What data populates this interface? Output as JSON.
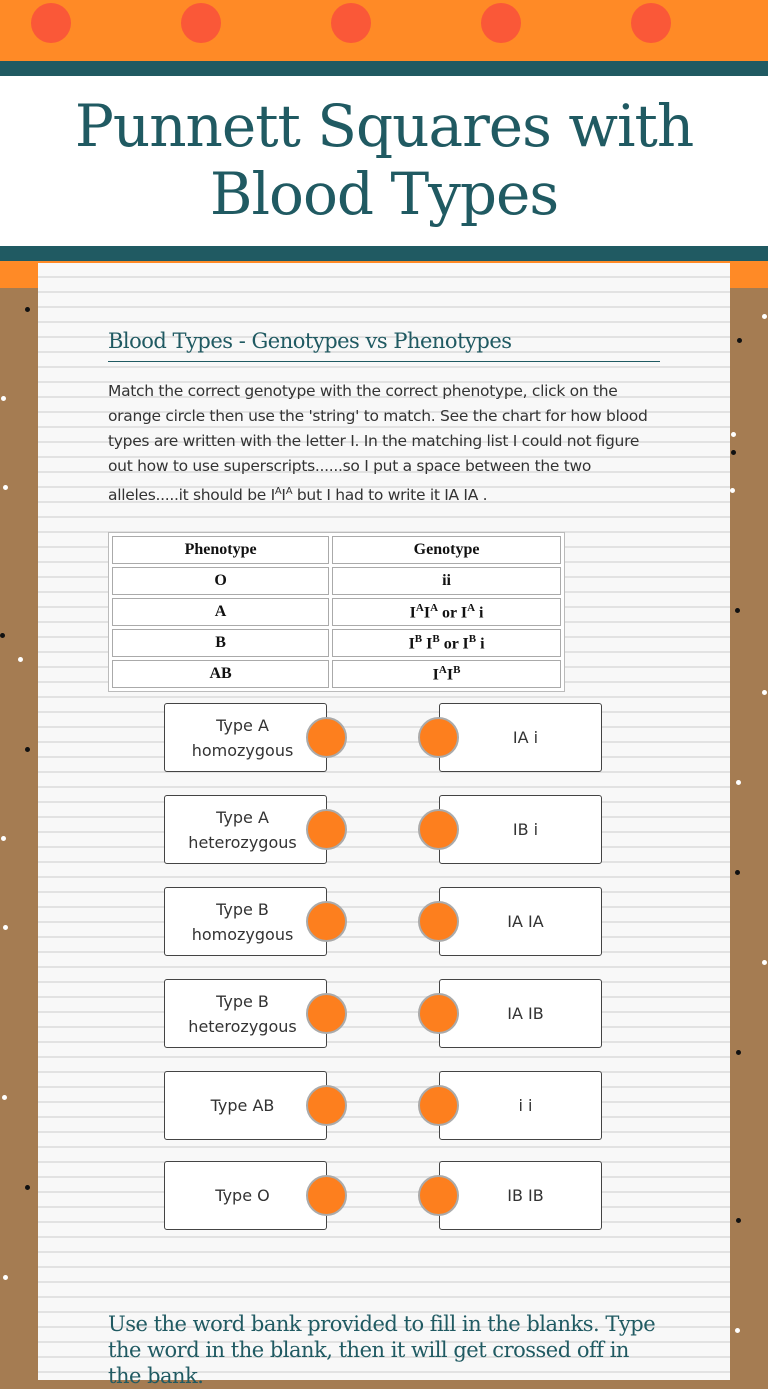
{
  "header": {
    "title": "Punnett Squares with Blood Types",
    "colors": {
      "orange": "#ff8a26",
      "dot": "#fa5838",
      "teal": "#205a62"
    }
  },
  "section": {
    "heading": "Blood Types - Genotypes vs Phenotypes",
    "instructions_part1": "Match the correct genotype with the correct phenotype, click on the orange circle then use the 'string' to match. See the chart for how blood types are written with the letter I.  In the matching list I could not figure out how to use superscripts......so I put a space between the two alleles.....it should be I",
    "instructions_sup1": "A",
    "instructions_mid": "I",
    "instructions_sup2": "A",
    "instructions_part2": "  but I had to write it IA IA ."
  },
  "table": {
    "headers": [
      "Phenotype",
      "Genotype"
    ],
    "rows": [
      {
        "phenotype": "O",
        "genotype": "ii"
      },
      {
        "phenotype": "A",
        "genotype": "IAIA or IA i"
      },
      {
        "phenotype": "B",
        "genotype": "IB IB or IB i"
      },
      {
        "phenotype": "AB",
        "genotype": "IAIB"
      }
    ]
  },
  "matching": {
    "left": [
      "Type A homozygous",
      "Type A heterozygous",
      "Type B homozygous",
      "Type B heterozygous",
      "Type AB",
      "Type O"
    ],
    "right": [
      "IA i",
      "IB i",
      "IA IA",
      "IA IB",
      "i i",
      "IB IB"
    ],
    "left_lines": [
      [
        "Type A",
        "homozygous"
      ],
      [
        "Type A",
        "heterozygous"
      ],
      [
        "Type B",
        "homozygous"
      ],
      [
        "Type B",
        "heterozygous"
      ],
      [
        "Type AB"
      ],
      [
        "Type O"
      ]
    ],
    "connector_color": "#fd7f1e"
  },
  "word_bank": {
    "instructions": "Use the word bank provided to fill in the blanks. Type the word in the blank, then it will get crossed off in the bank."
  }
}
